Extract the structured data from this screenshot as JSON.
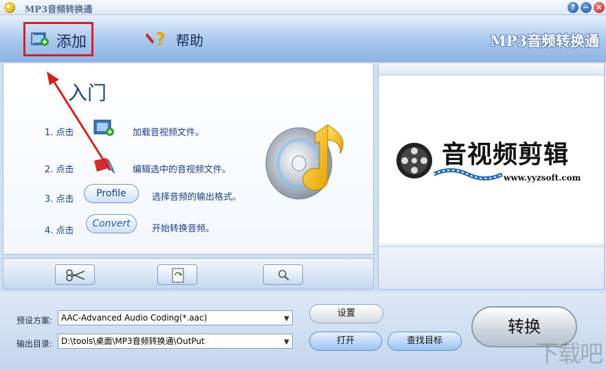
{
  "window": {
    "title": "MP3音频转换通",
    "help_btn": "?",
    "min_btn": "−",
    "close_btn": "×"
  },
  "toolbar": {
    "add_label": "添加",
    "help_label": "帮助",
    "brand": "MP3音频转换通"
  },
  "intro": {
    "title": "入门",
    "steps": [
      {
        "num": "1. 点击",
        "desc": "加载音视频文件。"
      },
      {
        "num": "2. 点击",
        "desc": "编辑选中的音视频文件。"
      },
      {
        "num": "3. 点击",
        "button": "Profile",
        "desc": "选择音频的输出格式。"
      },
      {
        "num": "4. 点击",
        "button": "Convert",
        "desc": "开始转换音频。"
      }
    ]
  },
  "tools": [
    "scissors-icon",
    "recycle-icon",
    "magnifier-icon"
  ],
  "preview": {
    "title": "音视频剪辑",
    "url": "www.yyzsoft.com"
  },
  "settings": {
    "preset_label": "预设方案:",
    "preset_value": "AAC-Advanced Audio Coding(*.aac)",
    "output_label": "输出目录:",
    "output_value": "D:\\tools\\桌面\\MP3音频转换通\\OutPut",
    "setup_btn": "设置",
    "open_btn": "打开",
    "find_btn": "查找目标",
    "convert_btn": "转换"
  },
  "watermark": "下载吧",
  "colors": {
    "highlight_red": "#d0231f",
    "accent_blue": "#1b3f8a"
  }
}
